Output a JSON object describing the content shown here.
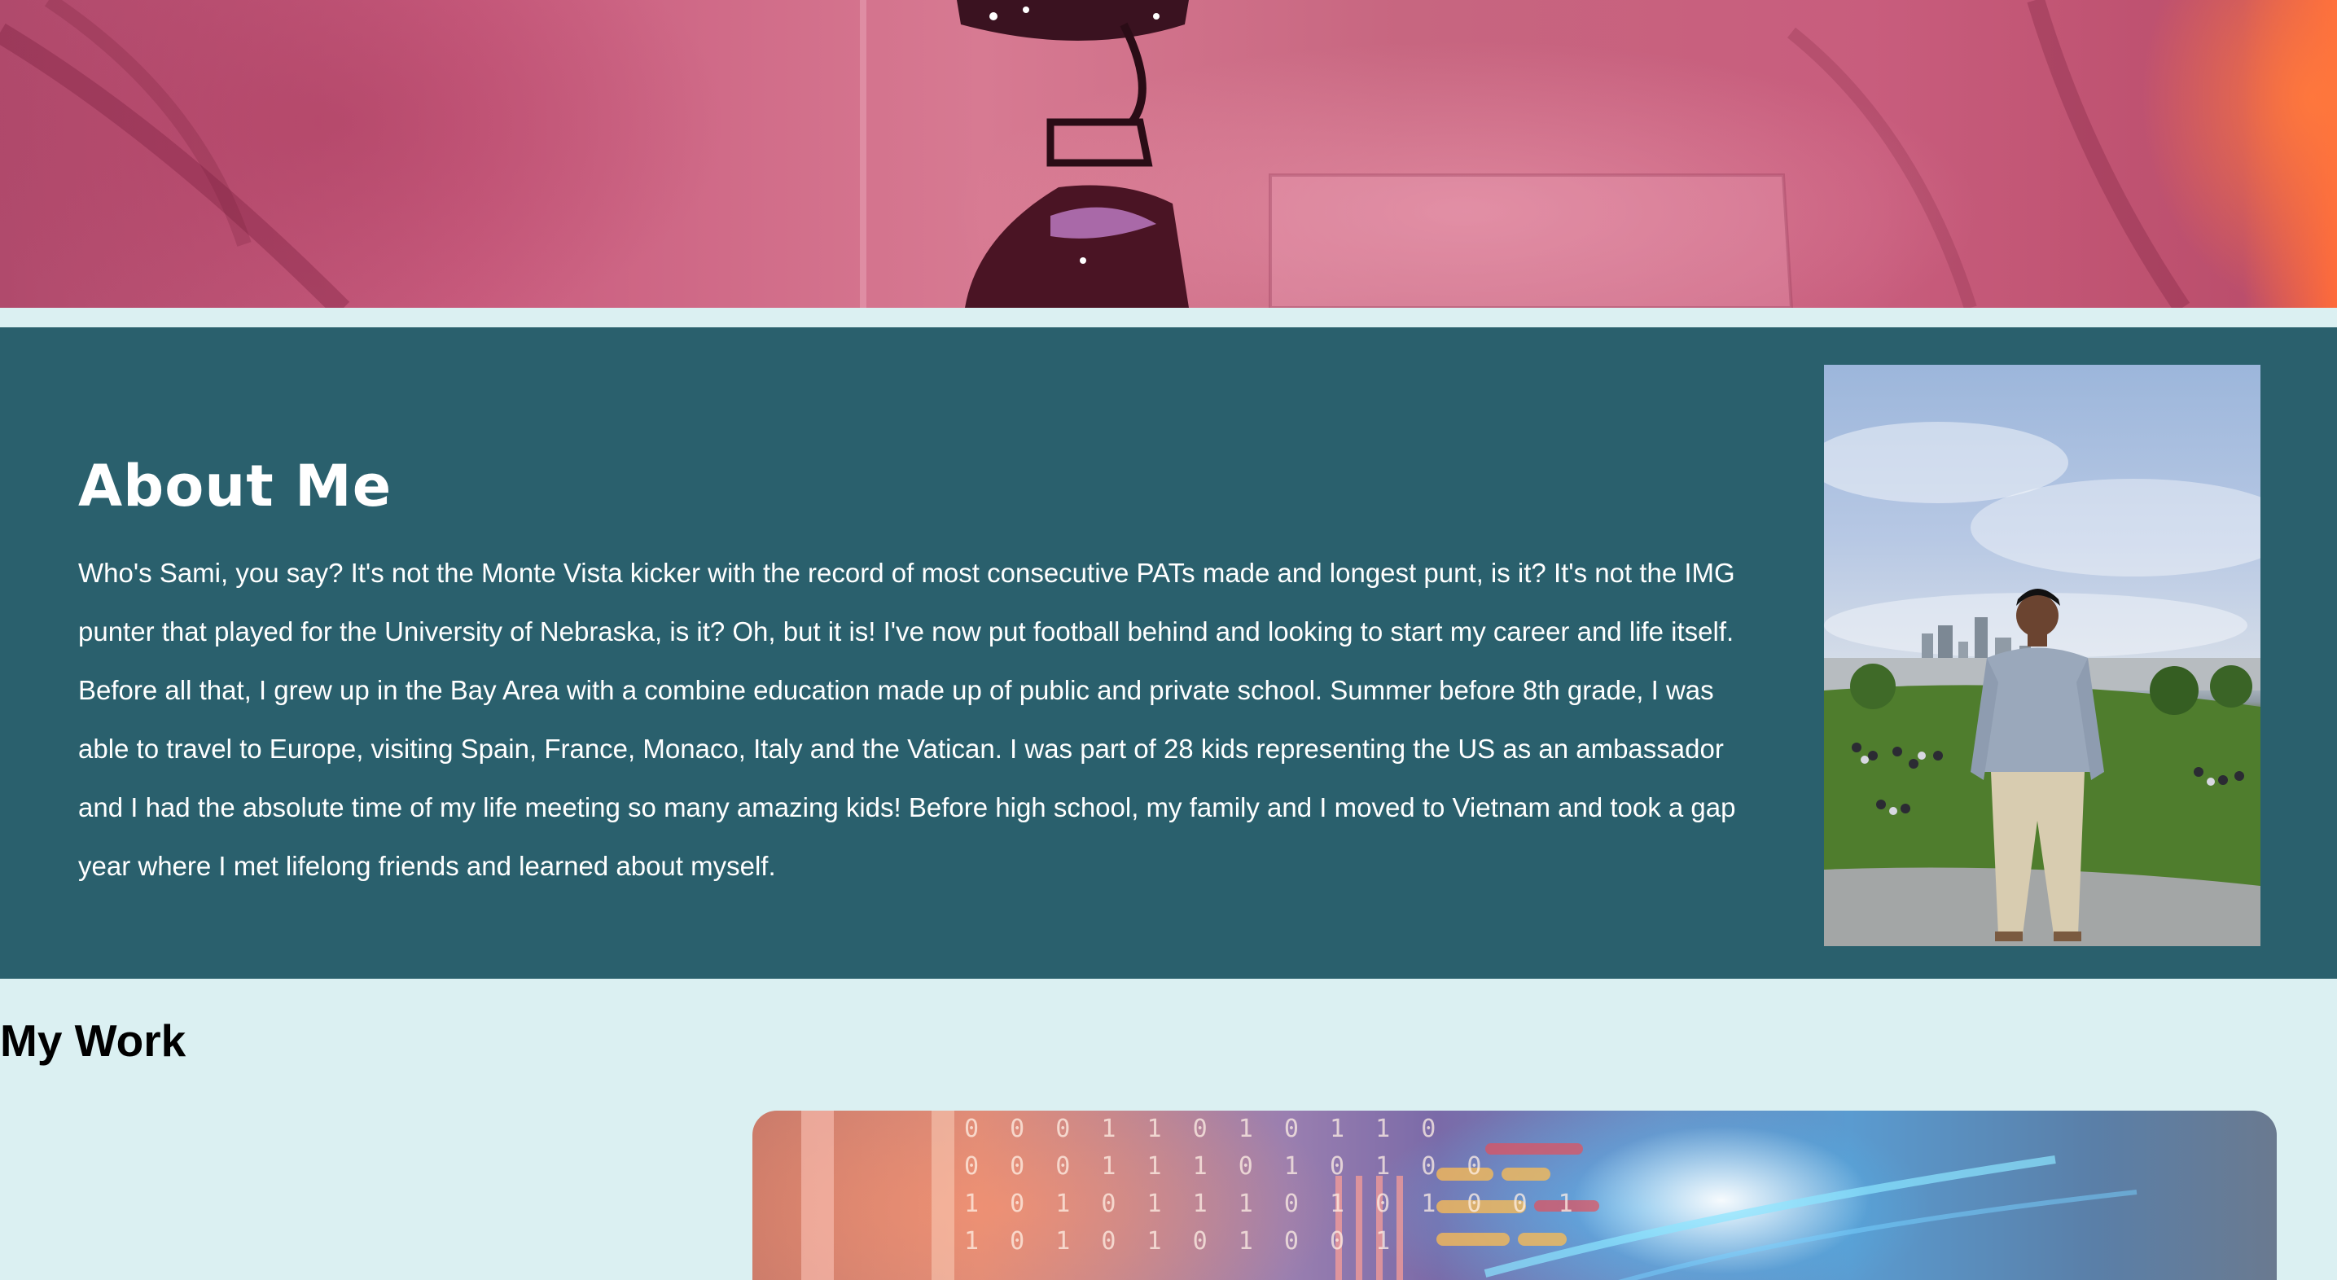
{
  "about": {
    "title": "About Me",
    "text": "Who's Sami, you say? It's not the Monte Vista kicker with the record of most consecutive PATs made and longest punt, is it? It's not the IMG punter that played for the University of Nebraska, is it? Oh, but it is! I've now put football behind and looking to start my career and life itself. Before all that, I grew up in the Bay Area with a combine education made up of public and private school. Summer before 8th grade, I was able to travel to Europe, visiting Spain, France, Monaco, Italy and the Vatican. I was part of 28 kids representing the US as an ambassador and I had the absolute time of my life meeting so many amazing kids! Before high school, my family and I moved to Vietnam and took a gap year where I met lifelong friends and learned about myself."
  },
  "work": {
    "title": "My Work"
  },
  "colors": {
    "page_background": "#dbf0f2",
    "about_background": "#2a606d",
    "about_text": "#ffffff",
    "work_title": "#000000"
  }
}
